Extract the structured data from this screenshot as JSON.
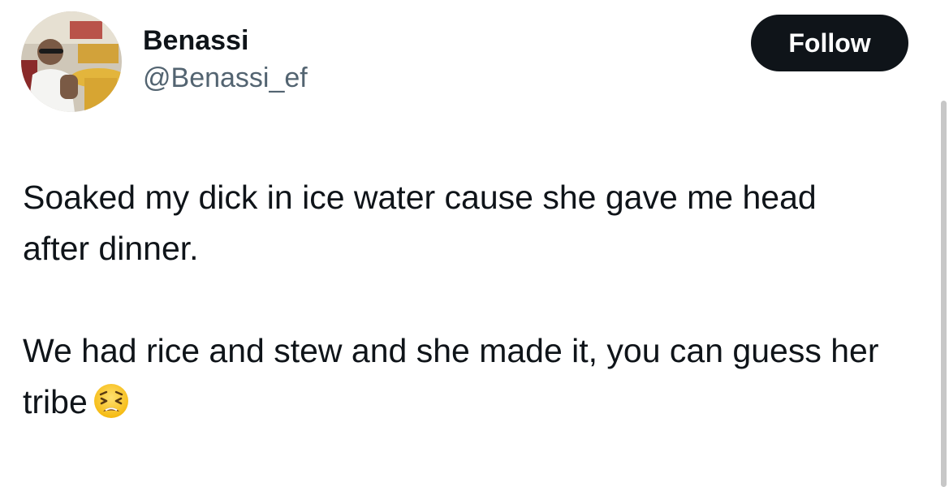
{
  "user": {
    "display_name": "Benassi",
    "handle": "@Benassi_ef"
  },
  "actions": {
    "follow_label": "Follow"
  },
  "tweet": {
    "paragraph1": "Soaked my dick in ice water cause she gave me head after dinner.",
    "paragraph2": "We had rice and stew and she made it, you can guess her tribe",
    "emoji_name": "weary-face-emoji"
  },
  "colors": {
    "text_primary": "#0f1419",
    "text_secondary": "#536471",
    "button_bg": "#0f1419",
    "button_text": "#ffffff"
  }
}
